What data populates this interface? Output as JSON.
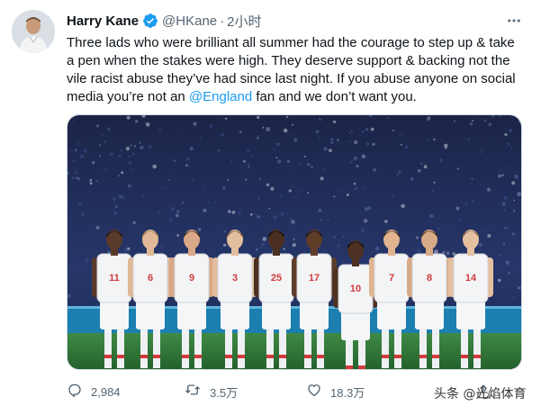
{
  "author": {
    "display_name": "Harry Kane",
    "handle": "@HKane",
    "separator": "·",
    "time": "2小时"
  },
  "tweet": {
    "text_before": "Three lads who were brilliant all summer had the courage to step up & take a pen when the stakes were high. They deserve support & backing not the vile racist abuse they’ve had since last night. If you abuse anyone on social media you’re not an ",
    "mention": "@England",
    "text_after": " fan and we don’t want you."
  },
  "players": [
    {
      "number": "11"
    },
    {
      "number": "6"
    },
    {
      "number": "9"
    },
    {
      "number": "3"
    },
    {
      "number": "25"
    },
    {
      "number": "17"
    },
    {
      "number": "10"
    },
    {
      "number": "7"
    },
    {
      "number": "8"
    },
    {
      "number": "14"
    }
  ],
  "actions": {
    "reply_count": "2,984",
    "retweet_count": "3.5万",
    "like_count": "18.3万"
  },
  "icons": {
    "verified": "verified-badge-icon",
    "more": "more-icon",
    "reply": "reply-icon",
    "retweet": "retweet-icon",
    "like": "heart-icon",
    "share": "share-icon"
  },
  "colors": {
    "accent": "#1d9bf0",
    "text": "#0f1419",
    "secondary": "#536471",
    "pitch": "#2f7d3a",
    "crowd": "#1e2a52"
  },
  "watermark": "头条 @光焰体育"
}
